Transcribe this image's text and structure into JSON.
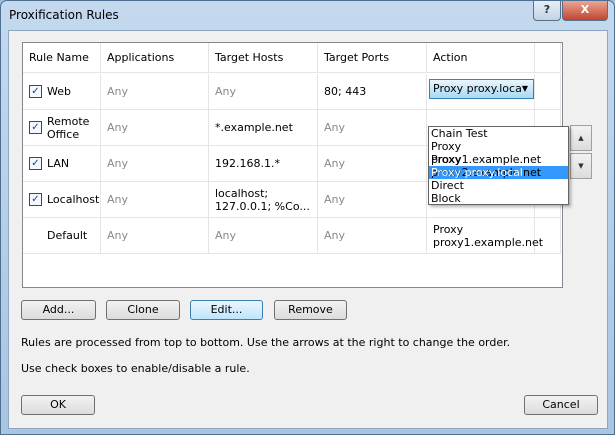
{
  "window": {
    "title": "Proxification Rules",
    "help_label": "?",
    "close_label": "X"
  },
  "table": {
    "headers": [
      "Rule Name",
      "Applications",
      "Target Hosts",
      "Target Ports",
      "Action"
    ],
    "rows": [
      {
        "checked": true,
        "name": "Web",
        "apps": "Any",
        "hosts": "Any",
        "ports": "80; 443",
        "action": "Proxy proxy.loca"
      },
      {
        "checked": true,
        "name": "Remote Office",
        "apps": "Any",
        "hosts": "*.example.net",
        "ports": "Any",
        "action": ""
      },
      {
        "checked": true,
        "name": "LAN",
        "apps": "Any",
        "hosts": "192.168.1.*",
        "ports": "Any",
        "action": ""
      },
      {
        "checked": true,
        "name": "Localhost",
        "apps": "Any",
        "hosts": "localhost; 127.0.0.1; %Co...",
        "ports": "Any",
        "action": "Direct"
      },
      {
        "checked": false,
        "name": "Default",
        "apps": "Any",
        "hosts": "Any",
        "ports": "Any",
        "action": "Proxy proxy1.example.net"
      }
    ]
  },
  "dropdown": {
    "options": [
      "Chain Test",
      "Proxy proxy1.example.net",
      "Proxy proxy2.example.net",
      "Proxy proxy.local",
      "Direct",
      "Block"
    ],
    "selected": "Proxy proxy.local"
  },
  "buttons": {
    "add": "Add...",
    "clone": "Clone",
    "edit": "Edit...",
    "remove": "Remove",
    "ok": "OK",
    "cancel": "Cancel",
    "up": "▲",
    "down": "▼"
  },
  "info": {
    "line1": "Rules are processed from top to bottom. Use the arrows at the right to change the order.",
    "line2": "Use check boxes to enable/disable a rule."
  },
  "check_mark": "✓"
}
